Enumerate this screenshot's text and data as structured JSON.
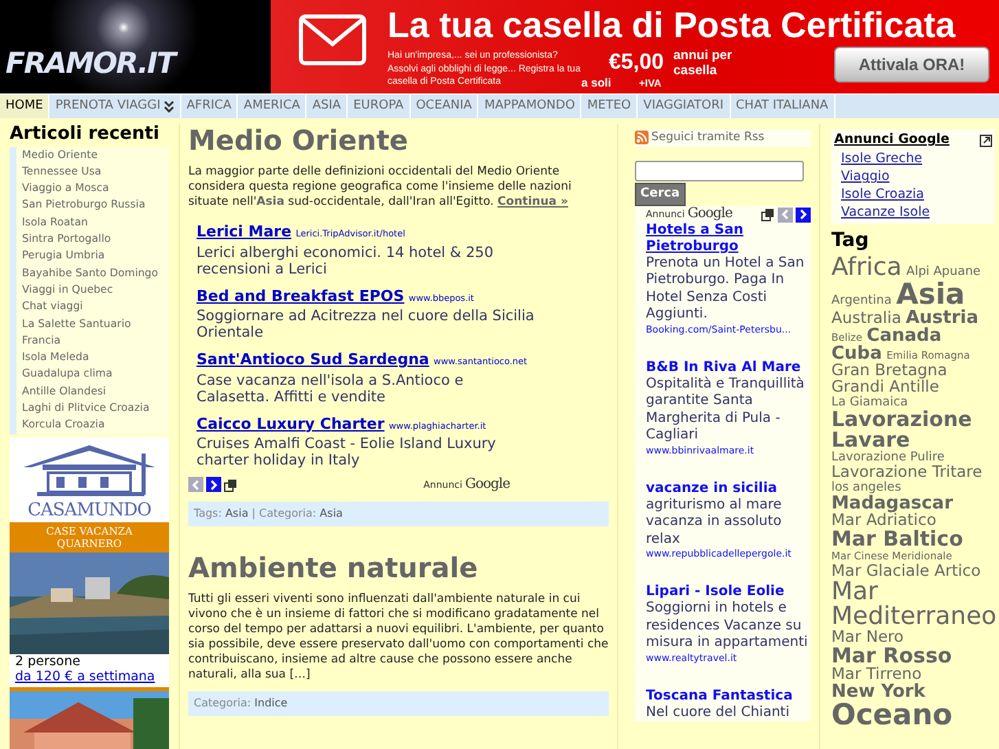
{
  "header": {
    "logo": "FRAMOR.IT",
    "banner": {
      "headline": "La tua casella di Posta Certificata",
      "body": "Hai un'impresa,... sei un professionista? Assolvi agli obblighi di legge... Registra la tua casella di Posta Certificata",
      "price_prefix": "a soli",
      "price": "€5,00",
      "price_suffix": "+IVA",
      "price_note": "annui per casella",
      "button": "Attivala ORA!"
    }
  },
  "nav": [
    {
      "label": "HOME",
      "selected": true,
      "dropdown": false
    },
    {
      "label": "PRENOTA VIAGGI",
      "selected": false,
      "dropdown": true
    },
    {
      "label": "AFRICA",
      "selected": false,
      "dropdown": false
    },
    {
      "label": "AMERICA",
      "selected": false,
      "dropdown": false
    },
    {
      "label": "ASIA",
      "selected": false,
      "dropdown": false
    },
    {
      "label": "EUROPA",
      "selected": false,
      "dropdown": false
    },
    {
      "label": "OCEANIA",
      "selected": false,
      "dropdown": false
    },
    {
      "label": "MAPPAMONDO",
      "selected": false,
      "dropdown": false
    },
    {
      "label": "METEO",
      "selected": false,
      "dropdown": false
    },
    {
      "label": "VIAGGIATORI",
      "selected": false,
      "dropdown": false
    },
    {
      "label": "CHAT ITALIANA",
      "selected": false,
      "dropdown": false
    }
  ],
  "sidebar": {
    "title": "Articoli recenti",
    "articles": [
      "Medio Oriente",
      "Tennessee Usa",
      "Viaggio a Mosca",
      "San Pietroburgo Russia",
      "Isola Roatan",
      "Sintra Portogallo",
      "Perugia Umbria",
      "Bayahibe Santo Domingo",
      "Viaggi in Quebec",
      "Chat viaggi",
      "La Salette Santuario Francia",
      "Isola Meleda",
      "Guadalupa clima",
      "Antille Olandesi",
      "Laghi di Plitvice Croazia",
      "Korcula Croazia"
    ],
    "promo": {
      "brand": "CASAMUNDO",
      "tagline": [
        "CASE VACANZA",
        "QUARNERO"
      ],
      "caption": "2 persone",
      "link": "da 120 € a settimana"
    }
  },
  "posts": [
    {
      "title": "Medio Oriente",
      "excerpt": "La maggior parte delle definizioni occidentali del Medio Oriente considera questa regione geografica come l'insieme delle nazioni situate nell'**Asia** sud-occidentale, dall'Iran all'Egitto.",
      "more": "Continua »",
      "ads": {
        "items": [
          {
            "title": "Lerici Mare",
            "url": "Lerici.TripAdvisor.it/hotel",
            "text": "Lerici alberghi economici. 14 hotel & 250 recensioni a Lerici"
          },
          {
            "title": "Bed and Breakfast EPOS",
            "url": "www.bbepos.it",
            "text": "Soggiornare ad Acitrezza nel cuore della Sicilia Orientale"
          },
          {
            "title": "Sant'Antioco Sud Sardegna",
            "url": "www.santantioco.net",
            "text": "Case vacanza nell'isola a S.Antioco e Calasetta. Affitti e vendite"
          },
          {
            "title": "Caicco Luxury Charter",
            "url": "www.plaghiacharter.it",
            "text": "Cruises Amalfi Coast - Eolie Island Luxury charter holiday in Italy"
          }
        ],
        "prev_enabled": false,
        "next_enabled": true,
        "by": {
          "prefix": "Annunci",
          "brand": "Google"
        }
      },
      "meta": [
        {
          "label": "Tags:",
          "value": "Asia"
        },
        {
          "label": "Categoria:",
          "value": "Asia"
        }
      ],
      "separator": "|"
    },
    {
      "title": "Ambiente naturale",
      "excerpt": "Tutti gli esseri viventi sono influenzati dall'ambiente naturale in cui vivono che è un insieme di fattori che si modificano gradatamente nel corso del tempo per adattarsi a nuovi equilibri. L'ambiente, per quanto sia possibile, deve essere preservato dall'uomo con comportamenti che contribuiscano, insieme ad altre cause che possono essere anche naturali, alla sua […]",
      "meta": [
        {
          "label": "Categoria:",
          "value": "Indice"
        }
      ]
    }
  ],
  "adcolumn": {
    "rss": "Seguici tramite Rss",
    "search_button": "Cerca",
    "by": {
      "prefix": "Annunci",
      "brand": "Google"
    },
    "prev_enabled": false,
    "next_enabled": true,
    "ads": [
      {
        "title": "Hotels a San Pietroburgo",
        "text": "Prenota un Hotel a San Pietroburgo. Paga In Hotel Senza Costi Aggiunti.",
        "url": "Booking.com/Saint-Petersbu...",
        "underlined": true
      },
      {
        "title": "B&B In Riva Al Mare",
        "text": "Ospitalità e Tranquillità garantite Santa Margherita di Pula - Cagliari",
        "url": "www.bbinrivaalmare.it",
        "underlined": false
      },
      {
        "title": "vacanze in sicilia",
        "text": "agriturismo al mare vacanza in assoluto relax",
        "url": "www.repubblicadellepergole.it",
        "underlined": false
      },
      {
        "title": "Lipari - Isole Eolie",
        "text": "Soggiorni in hotels e residences Vacanze su misura in appartamenti",
        "url": "www.realtytravel.it",
        "underlined": false
      },
      {
        "title": "Toscana Fantastica",
        "text": "Nel cuore del Chianti",
        "underlined": false
      }
    ]
  },
  "tagcolumn": {
    "links_title": "Annunci Google",
    "links": [
      "Isole Greche",
      "Viaggio",
      "Isole Croazia",
      "Vacanze Isole"
    ],
    "title": "Tag",
    "tags": [
      {
        "label": "Africa",
        "kind": "xl"
      },
      {
        "label": "Alpi Apuane",
        "kind": "s"
      },
      {
        "label": "Argentina",
        "kind": "s"
      },
      {
        "label": "Asia",
        "kind": "xxl"
      },
      {
        "label": "Australia",
        "kind": "m"
      },
      {
        "label": "Austria",
        "kind": "lb"
      },
      {
        "label": "Belize",
        "kind": "xs"
      },
      {
        "label": "Canada",
        "kind": "lb"
      },
      {
        "label": "Cuba",
        "kind": "lb"
      },
      {
        "label": "Emilia Romagna",
        "kind": "xs"
      },
      {
        "label": "Gran Bretagna",
        "kind": "m"
      },
      {
        "label": "Grandi Antille",
        "kind": "m"
      },
      {
        "label": "La Giamaica",
        "kind": "s"
      },
      {
        "label": "Lavorazione Lavare",
        "kind": "l"
      },
      {
        "label": "Lavorazione Pulire",
        "kind": "s"
      },
      {
        "label": "Lavorazione Tritare",
        "kind": "m"
      },
      {
        "label": "los angeles",
        "kind": "s"
      },
      {
        "label": "Madagascar",
        "kind": "lb"
      },
      {
        "label": "Mar Adriatico",
        "kind": "m"
      },
      {
        "label": "Mar Baltico",
        "kind": "l"
      },
      {
        "label": "Mar Cinese Meridionale",
        "kind": "xs"
      },
      {
        "label": "Mar Glaciale Artico",
        "kind": "m"
      },
      {
        "label": "Mar Mediterraneo",
        "kind": "xl"
      },
      {
        "label": "Mar Nero",
        "kind": "m"
      },
      {
        "label": "Mar Rosso",
        "kind": "l"
      },
      {
        "label": "Mar Tirreno",
        "kind": "m"
      },
      {
        "label": "New York",
        "kind": "lb"
      },
      {
        "label": "Oceano",
        "kind": "xxl"
      }
    ]
  }
}
